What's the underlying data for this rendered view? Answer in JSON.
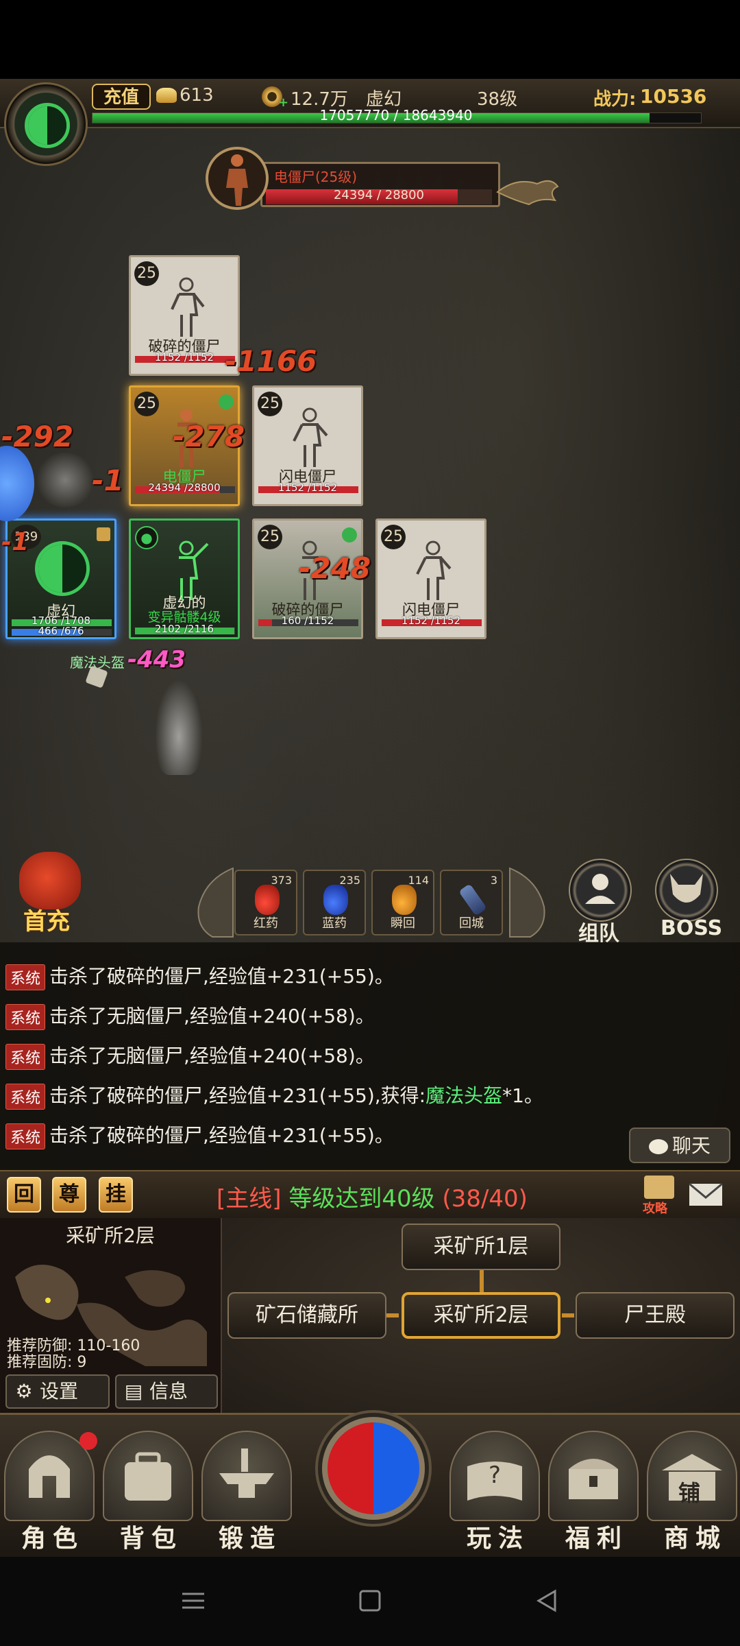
{
  "topbar": {
    "recharge": "充值",
    "gold": "613",
    "coins": "12.7万",
    "char_name": "虚幻",
    "level": "38级",
    "power_label": "战力:",
    "power_value": "10536",
    "xp_text": "17057770 / 18643940",
    "xp_fraction": 0.915
  },
  "boss": {
    "name": "电僵尸(25级)",
    "hp_text": "24394 / 28800",
    "hp_fraction": 0.847
  },
  "units": [
    {
      "level": "25",
      "name": "破碎的僵尸",
      "hp": "1152 /1152",
      "hp_fraction": 1.0
    },
    {
      "level": "25",
      "name": "电僵尸",
      "hp": "24394 /28800",
      "hp_fraction": 0.847
    },
    {
      "level": "25",
      "name": "闪电僵尸",
      "hp": "1152 /1152",
      "hp_fraction": 1.0
    },
    {
      "level": "139",
      "name": "虚幻",
      "hp": "1706 /1708",
      "mp": "466 /676",
      "hp_fraction": 0.998,
      "mp_fraction": 0.689
    },
    {
      "name": "虚幻的",
      "subname": "变异骷髅4级",
      "hp": "2102 /2116",
      "hp_fraction": 0.993
    },
    {
      "level": "25",
      "name": "破碎的僵尸",
      "hp": "160 /1152",
      "hp_fraction": 0.139
    },
    {
      "level": "25",
      "name": "闪电僵尸",
      "hp": "1152 /1152",
      "hp_fraction": 1.0
    }
  ],
  "damage": {
    "d1": "-1166",
    "d2": "-278",
    "d3": "-292",
    "d4": "-1",
    "d5": "-1",
    "d6": "-248",
    "d7": "-443",
    "drop_label": "魔法头盔"
  },
  "actions": {
    "first_charge": "首充",
    "potions": [
      {
        "count": "373",
        "label": "红药"
      },
      {
        "count": "235",
        "label": "蓝药"
      },
      {
        "count": "114",
        "label": "瞬回"
      },
      {
        "count": "3",
        "label": "回城"
      }
    ],
    "team": "组队",
    "boss": "BOSS"
  },
  "chat": {
    "tag": "系统",
    "lines": [
      "击杀了破碎的僵尸,经验值+231(+55)。",
      "击杀了无脑僵尸,经验值+240(+58)。",
      "击杀了无脑僵尸,经验值+240(+58)。",
      "击杀了破碎的僵尸,经验值+231(+55),获得:",
      "击杀了破碎的僵尸,经验值+231(+55)。"
    ],
    "drop_item": "魔法头盔",
    "drop_suffix": "*1。",
    "chat_button": "聊天"
  },
  "quest": {
    "btn1": "回",
    "btn2": "尊",
    "btn3": "挂",
    "tag": "[主线]",
    "text": "等级达到40级",
    "progress": "(38/40)",
    "guide": "攻略"
  },
  "map": {
    "name": "采矿所2层",
    "rec1": "推荐防御:  110-160",
    "rec2": "推荐固防:  9",
    "settings": "设置",
    "info": "信息",
    "routes": {
      "top": "采矿所1层",
      "left": "矿石储藏所",
      "current": "采矿所2层",
      "right": "尸王殿"
    }
  },
  "nav": {
    "items": [
      "角色",
      "背包",
      "锻造",
      "玩法",
      "福利",
      "商城"
    ],
    "shop_sign": "铺"
  }
}
